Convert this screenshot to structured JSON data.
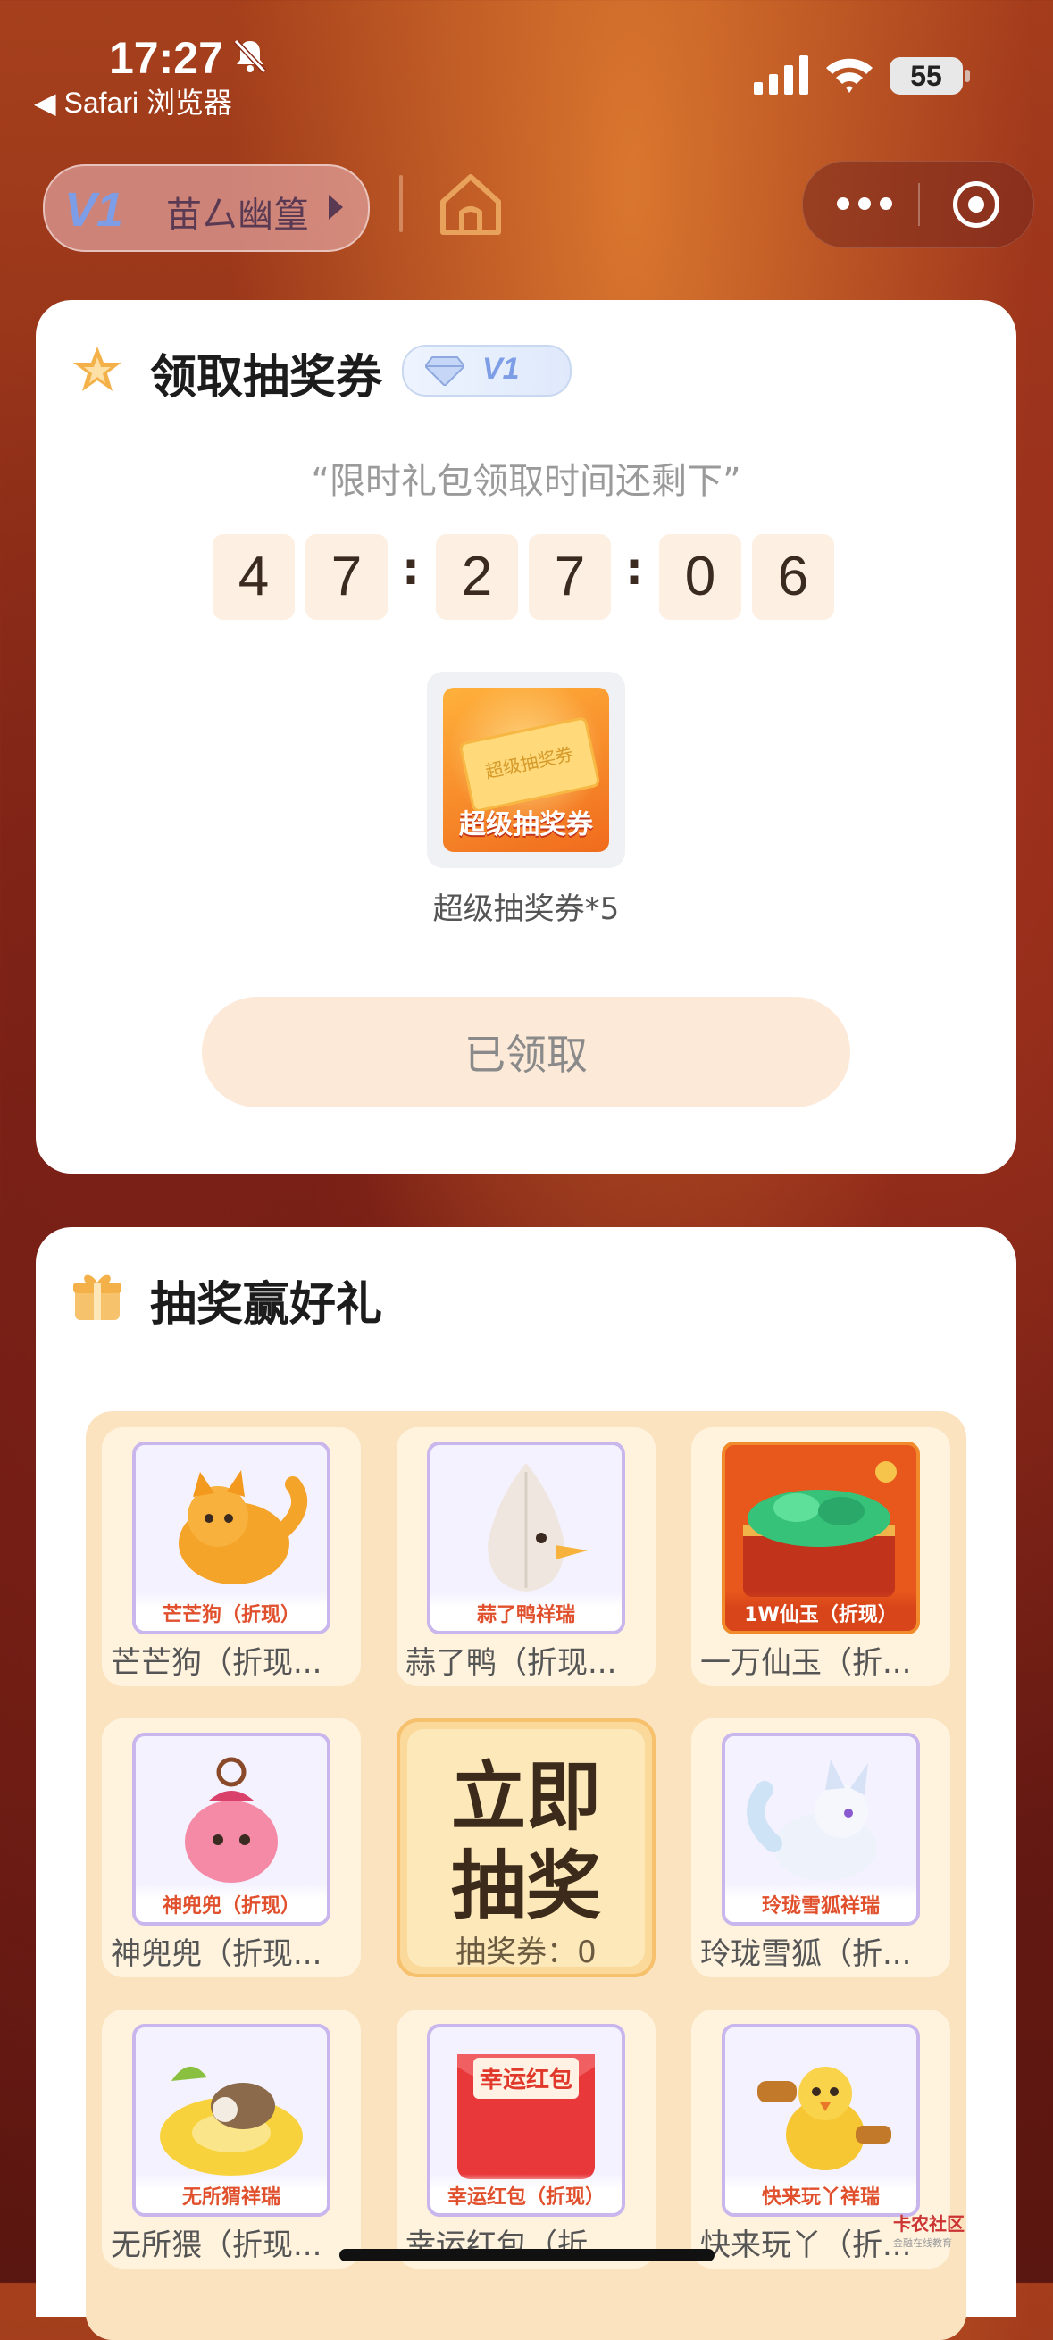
{
  "status_bar": {
    "time": "17:27",
    "back_app": "◀ Safari 浏览器",
    "battery": "55"
  },
  "nav": {
    "vip_level": "V1",
    "user_name": "苗厶幽篁"
  },
  "voucher_card": {
    "title": "领取抽奖券",
    "level_badge": "V1",
    "subtitle": "“限时礼包领取时间还剩下”",
    "countdown": [
      "4",
      "7",
      "2",
      "7",
      "0",
      "6"
    ],
    "colon": ":",
    "prize_ticket_text": "超级抽奖券",
    "prize_label": "超级抽奖券",
    "prize_caption": "超级抽奖券*5",
    "claim_button": "已领取"
  },
  "lottery_card": {
    "title": "抽奖赢好礼",
    "prizes": [
      {
        "tag": "芒芒狗（折现）",
        "label": "芒芒狗（折现..."
      },
      {
        "tag": "蒜了鸭祥瑞",
        "label": "蒜了鸭（折现..."
      },
      {
        "tag": "1W仙玉（折现）",
        "label": "一万仙玉（折..."
      },
      {
        "tag": "神兜兜（折现）",
        "label": "神兜兜（折现..."
      },
      {
        "tag": "玲珑雪狐祥瑞",
        "label": "玲珑雪狐（折..."
      },
      {
        "tag": "无所猬祥瑞",
        "label": "无所猥（折现..."
      },
      {
        "tag": "幸运红包（折现）",
        "label": "幸运红包（折...",
        "inner": "幸运红包"
      },
      {
        "tag": "快来玩丫祥瑞",
        "label": "快来玩丫（折..."
      }
    ],
    "draw_button": {
      "line1": "立即",
      "line2": "抽奖",
      "count": "抽奖券：0"
    }
  },
  "watermark": {
    "name": "卡农社区",
    "sub": "金融在线教育"
  }
}
